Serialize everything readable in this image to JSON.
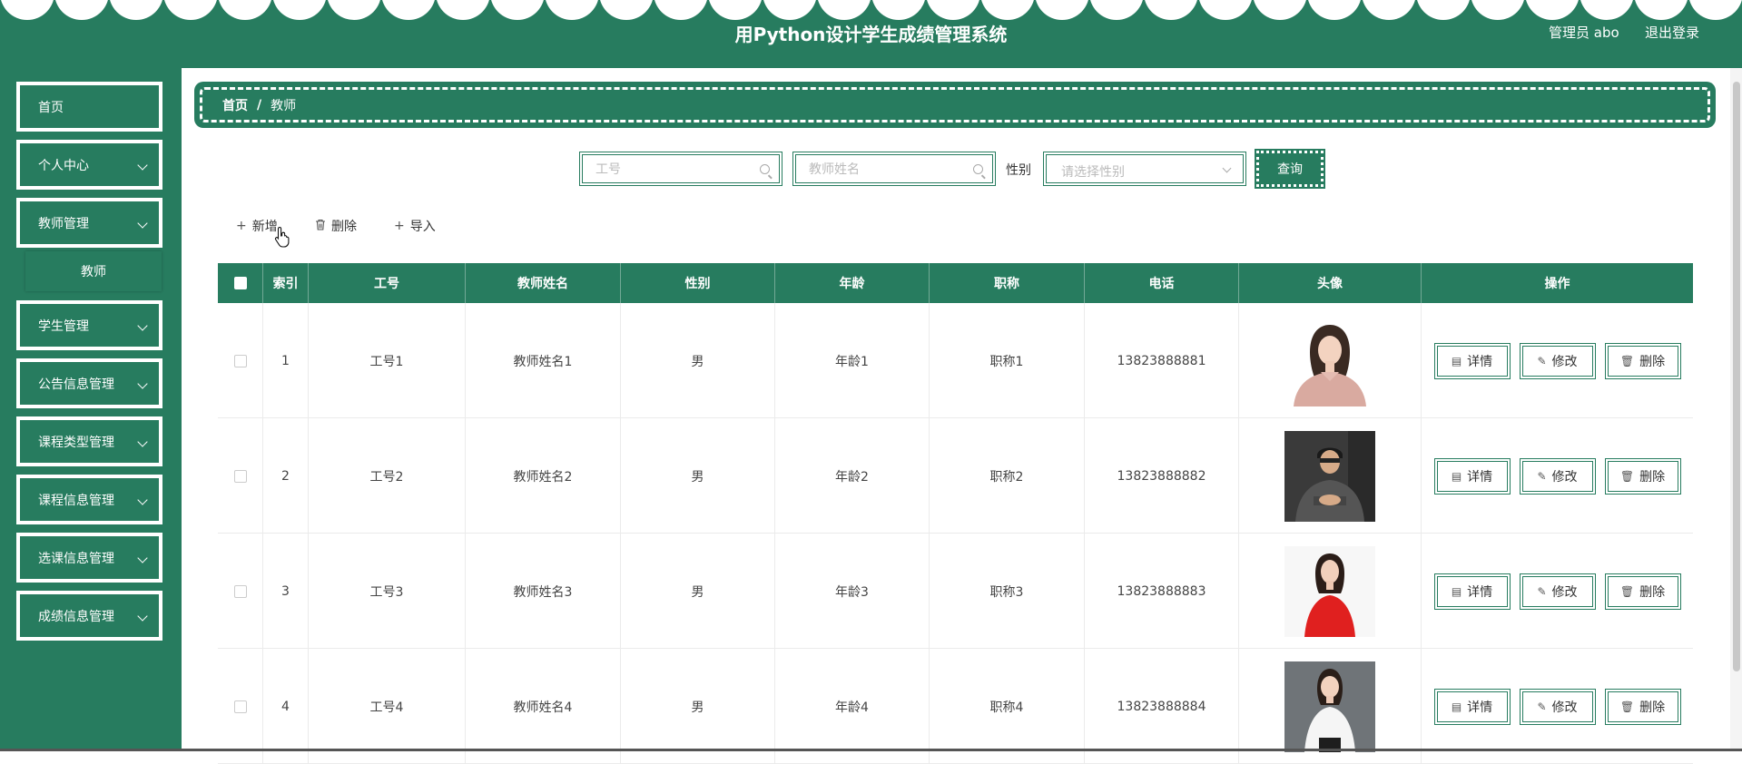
{
  "header": {
    "title": "用Python设计学生成绩管理系统",
    "user_label": "管理员 abo",
    "logout_label": "退出登录"
  },
  "sidebar": {
    "items": [
      {
        "label": "首页"
      },
      {
        "label": "个人中心"
      },
      {
        "label": "教师管理"
      },
      {
        "label": "学生管理"
      },
      {
        "label": "公告信息管理"
      },
      {
        "label": "课程类型管理"
      },
      {
        "label": "课程信息管理"
      },
      {
        "label": "选课信息管理"
      },
      {
        "label": "成绩信息管理"
      }
    ],
    "sub_item": {
      "label": "教师"
    }
  },
  "breadcrumb": {
    "home": "首页",
    "separator": "/",
    "current": "教师"
  },
  "search": {
    "id_placeholder": "工号",
    "name_placeholder": "教师姓名",
    "gender_label": "性别",
    "gender_placeholder": "请选择性别",
    "query_label": "查询"
  },
  "actions": {
    "add": "新增",
    "delete": "删除",
    "import": "导入"
  },
  "table": {
    "headers": [
      "索引",
      "工号",
      "教师姓名",
      "性别",
      "年龄",
      "职称",
      "电话",
      "头像",
      "操作"
    ],
    "rows": [
      {
        "index": "1",
        "id": "工号1",
        "name": "教师姓名1",
        "gender": "男",
        "age": "年龄1",
        "title": "职称1",
        "phone": "13823888881"
      },
      {
        "index": "2",
        "id": "工号2",
        "name": "教师姓名2",
        "gender": "男",
        "age": "年龄2",
        "title": "职称2",
        "phone": "13823888882"
      },
      {
        "index": "3",
        "id": "工号3",
        "name": "教师姓名3",
        "gender": "男",
        "age": "年龄3",
        "title": "职称3",
        "phone": "13823888883"
      },
      {
        "index": "4",
        "id": "工号4",
        "name": "教师姓名4",
        "gender": "男",
        "age": "年龄4",
        "title": "职称4",
        "phone": "13823888884"
      }
    ],
    "ops": {
      "detail": "详情",
      "edit": "修改",
      "delete": "删除"
    }
  },
  "colors": {
    "brand": "#277c5f"
  }
}
